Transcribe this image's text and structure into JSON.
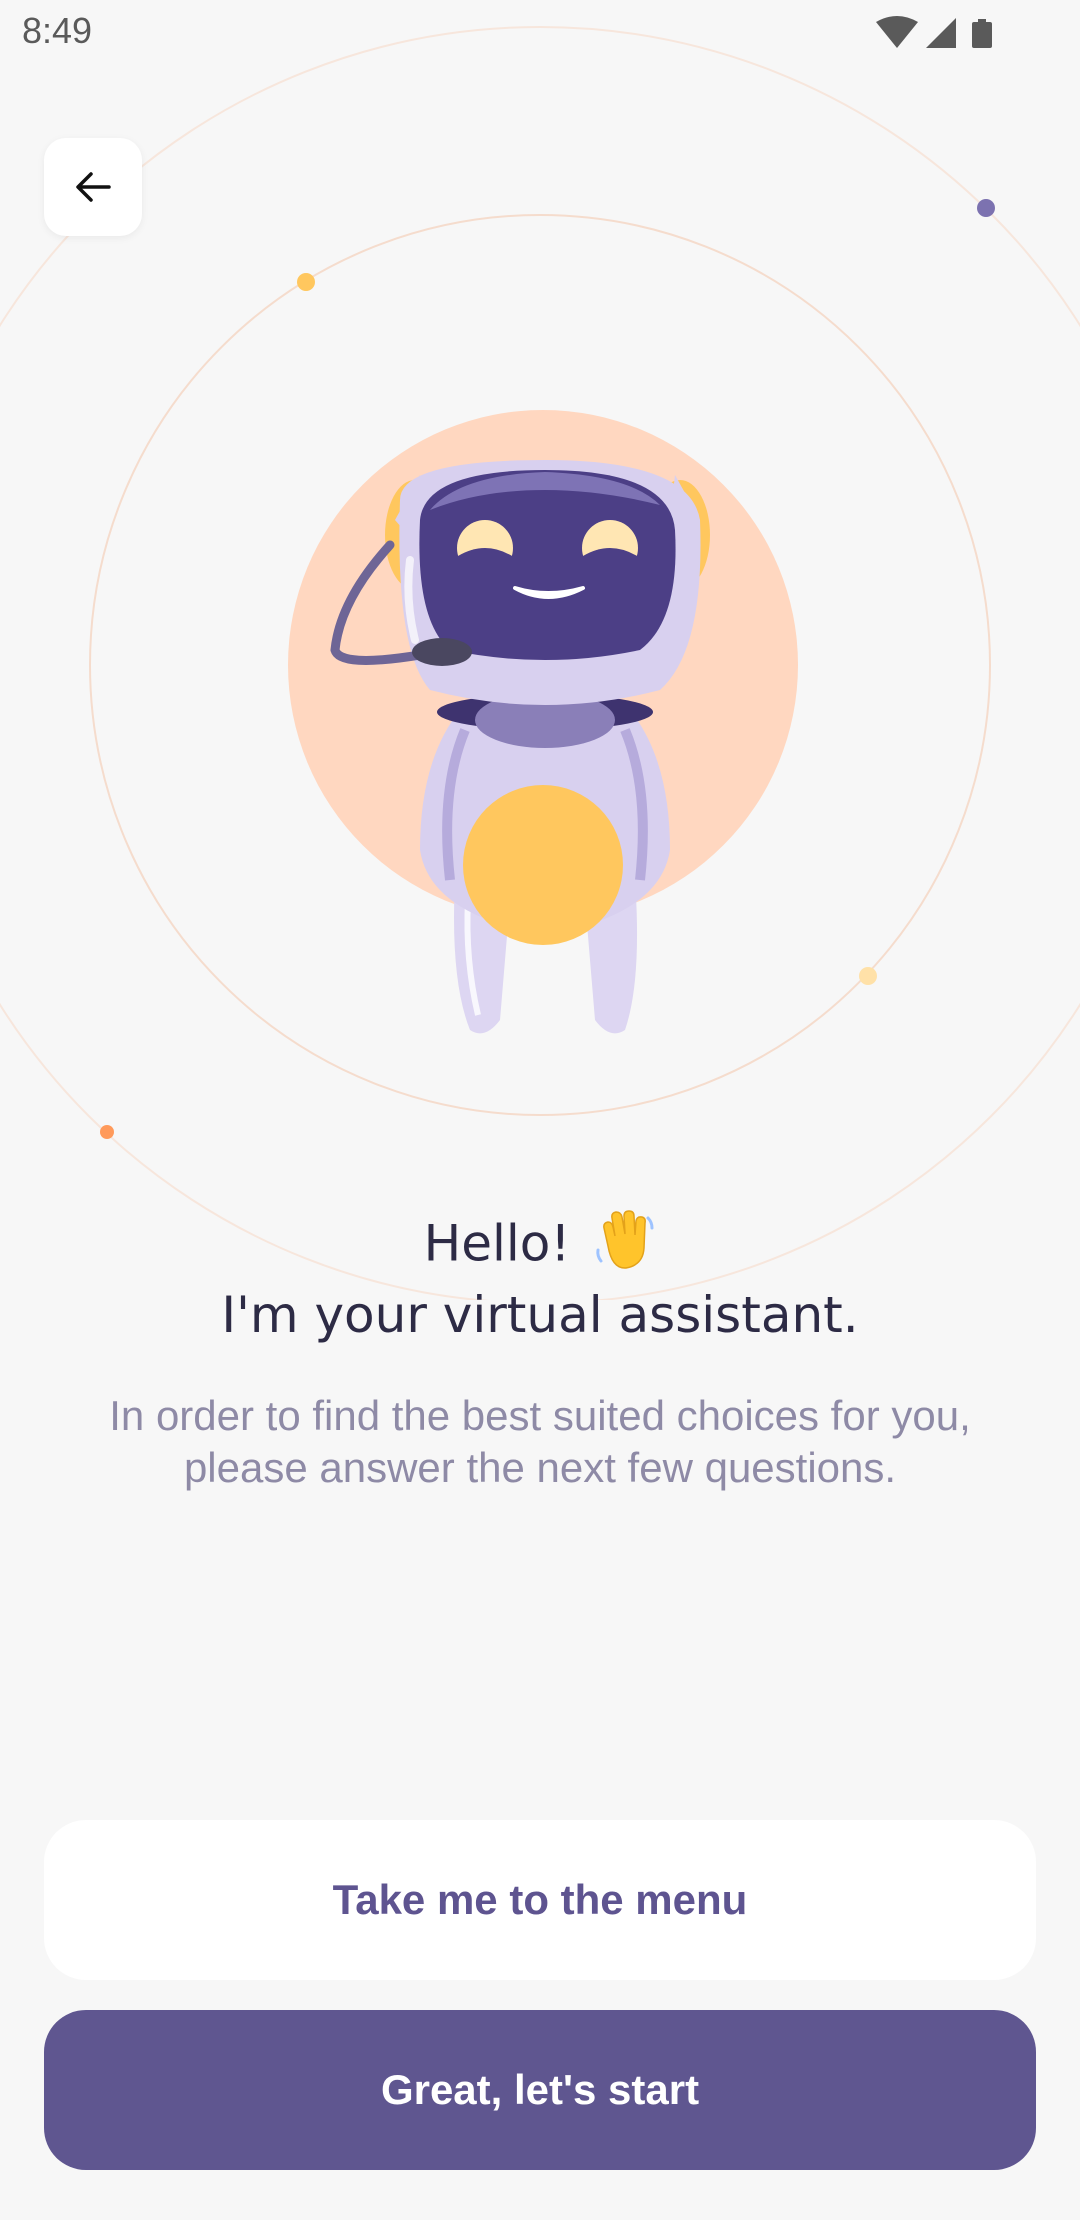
{
  "status_bar": {
    "time": "8:49",
    "icons": [
      "wifi-icon",
      "cellular-signal-icon",
      "battery-icon"
    ]
  },
  "header": {
    "back_icon": "arrow-left-icon"
  },
  "illustration": {
    "subject": "robot-assistant-mascot",
    "accent_colors": {
      "peach": "#ffd7c0",
      "purple": "#4c3f86",
      "lavender": "#d8d0ef",
      "yellow": "#ffc75e",
      "orbit": "#f7e0d2",
      "dot_purple": "#7c72b0",
      "dot_orange": "#ff9a5b"
    }
  },
  "greeting": {
    "line1": "Hello!",
    "emoji": "👋",
    "line2": "I'm your virtual assistant."
  },
  "description": "In order to find the best suited choices for you, please answer the next few questions.",
  "actions": {
    "secondary_label": "Take me to the menu",
    "primary_label": "Great, let's start"
  },
  "colors": {
    "background": "#f7f7f7",
    "primary": "#5f5690",
    "title_text": "#2d2b45",
    "body_text": "#8e8aa6"
  }
}
